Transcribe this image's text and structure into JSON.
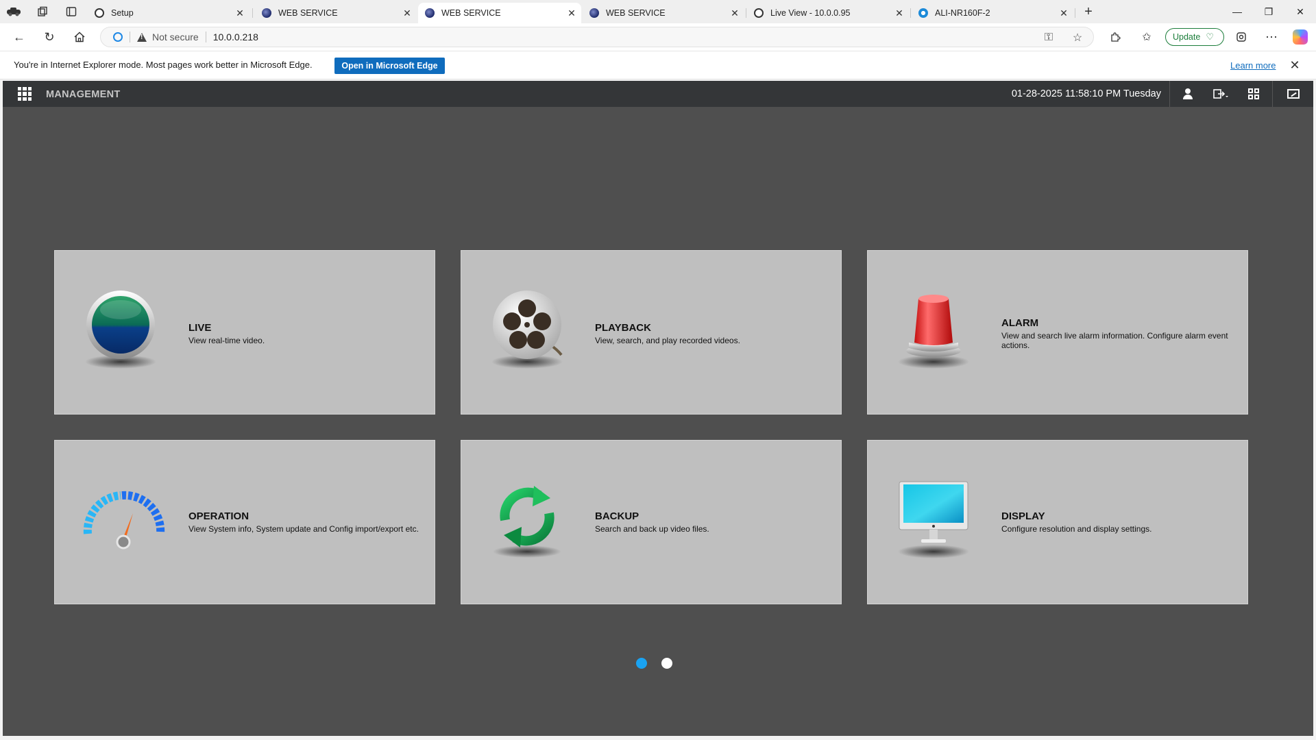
{
  "browser": {
    "tabs": [
      {
        "label": "Setup",
        "favicon": "ie-icon",
        "active": false
      },
      {
        "label": "WEB SERVICE",
        "favicon": "web-service-icon",
        "active": false
      },
      {
        "label": "WEB SERVICE",
        "favicon": "web-service-icon",
        "active": true
      },
      {
        "label": "WEB SERVICE",
        "favicon": "web-service-icon",
        "active": false
      },
      {
        "label": "Live View - 10.0.0.95",
        "favicon": "ie-icon",
        "active": false
      },
      {
        "label": "ALI-NR160F-2",
        "favicon": "gear-icon",
        "active": false
      }
    ],
    "address": {
      "security_label": "Not secure",
      "url": "10.0.0.218"
    },
    "update_label": "Update",
    "infobar": {
      "message": "You're in Internet Explorer mode. Most pages work better in Microsoft Edge.",
      "open_button": "Open in Microsoft Edge",
      "learn_more": "Learn more"
    }
  },
  "app": {
    "header": {
      "title": "MANAGEMENT",
      "datetime": "01-28-2025 11:58:10 PM Tuesday"
    },
    "tiles": [
      {
        "title": "LIVE",
        "desc": "View real-time video.",
        "icon": "live-icon"
      },
      {
        "title": "PLAYBACK",
        "desc": "View, search, and play recorded videos.",
        "icon": "film-reel-icon"
      },
      {
        "title": "ALARM",
        "desc": "View and search live alarm information. Configure alarm event actions.",
        "icon": "alarm-siren-icon"
      },
      {
        "title": "OPERATION",
        "desc": "View System info, System update and Config import/export etc.",
        "icon": "gauge-icon"
      },
      {
        "title": "BACKUP",
        "desc": "Search and back up video files.",
        "icon": "refresh-icon"
      },
      {
        "title": "DISPLAY",
        "desc": "Configure resolution and display settings.",
        "icon": "monitor-icon"
      }
    ],
    "pager": {
      "pages": 2,
      "current": 1,
      "active_color": "#1aa3f2",
      "inactive_color": "#ffffff"
    }
  }
}
